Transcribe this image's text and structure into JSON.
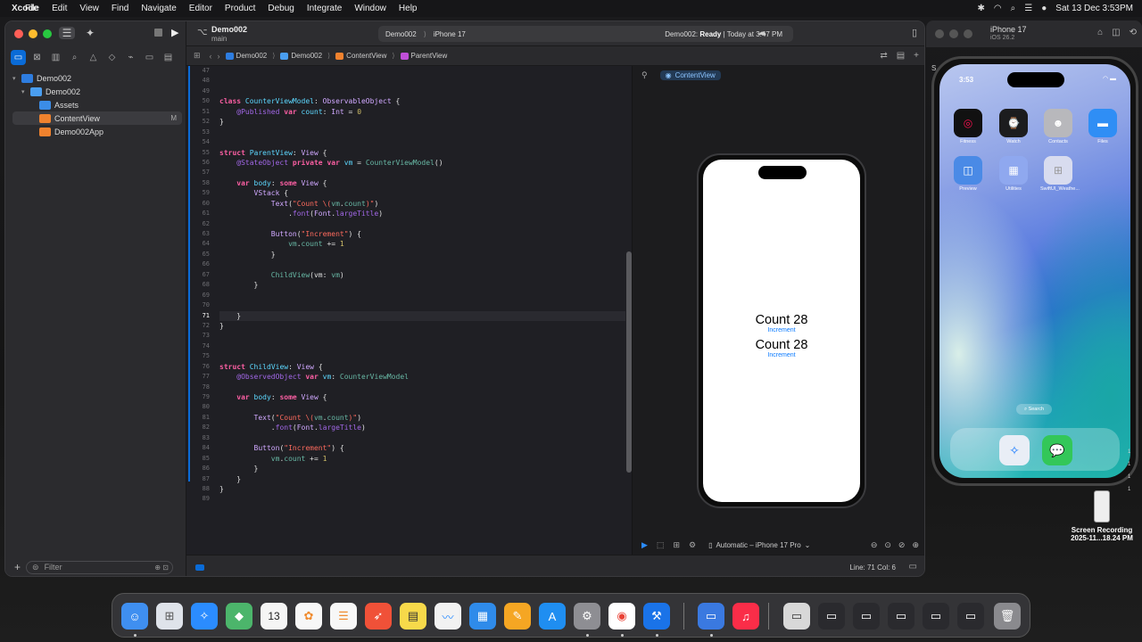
{
  "menubar": {
    "app": "Xcode",
    "items": [
      "File",
      "Edit",
      "View",
      "Find",
      "Navigate",
      "Editor",
      "Product",
      "Debug",
      "Integrate",
      "Window",
      "Help"
    ],
    "clock": "Sat 13 Dec  3:53PM"
  },
  "xcode": {
    "project": "Demo002",
    "branch": "main",
    "scheme": {
      "target": "Demo002",
      "device": "iPhone 17",
      "status_prefix": "Demo002: ",
      "status_bold": "Ready",
      "status_suffix": " | Today at 3:47 PM"
    },
    "navigator": {
      "items": [
        {
          "label": "Demo002",
          "level": 0,
          "badge": ""
        },
        {
          "label": "Demo002",
          "level": 1,
          "badge": ""
        },
        {
          "label": "Assets",
          "level": 2,
          "badge": ""
        },
        {
          "label": "ContentView",
          "level": 2,
          "badge": "M"
        },
        {
          "label": "Demo002App",
          "level": 2,
          "badge": ""
        }
      ],
      "filter_placeholder": "Filter"
    },
    "jumpbar": [
      "Demo002",
      "Demo002",
      "ContentView",
      "ParentView"
    ],
    "editor": {
      "line_numbers": [
        47,
        48,
        49,
        50,
        51,
        52,
        53,
        54,
        55,
        56,
        57,
        58,
        59,
        60,
        61,
        62,
        63,
        64,
        65,
        66,
        67,
        68,
        69,
        70,
        71,
        72,
        73,
        74,
        75,
        76,
        77,
        78,
        79,
        80,
        81,
        82,
        83,
        84,
        85,
        86,
        87,
        88,
        89
      ],
      "current_line": 71
    },
    "footer": {
      "position": "Line: 71  Col: 6"
    },
    "canvas": {
      "tab": "ContentView",
      "preview": [
        {
          "count": "Count 28",
          "button": "Increment"
        },
        {
          "count": "Count 28",
          "button": "Increment"
        }
      ],
      "device": "Automatic – iPhone 17 Pro"
    }
  },
  "simulator": {
    "title": "iPhone 17",
    "os": "iOS 26.2",
    "time": "3:53",
    "apps": [
      "Fitness",
      "Watch",
      "Contacts",
      "Files",
      "Preview",
      "Utilities",
      "SwiftUI_Weathe..."
    ],
    "search": "Search"
  },
  "screen_recording": {
    "line1": "Screen Recording",
    "line2": "2025-11...18.24 PM"
  },
  "side_label": "S",
  "side_digits": [
    "1",
    "1",
    "1",
    "1"
  ]
}
